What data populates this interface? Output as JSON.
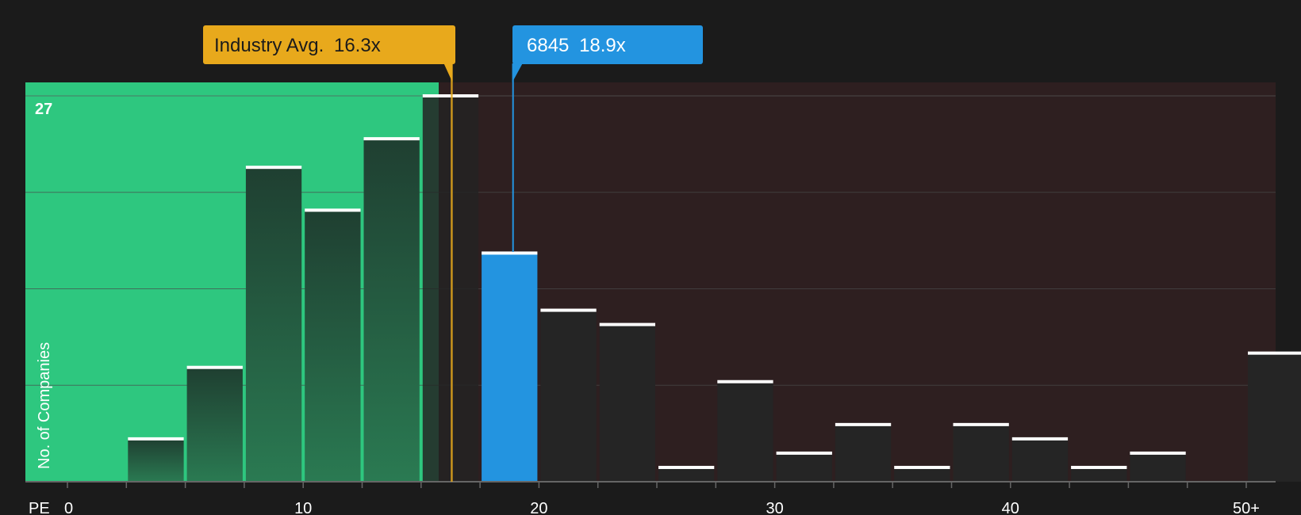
{
  "chart_data": {
    "type": "bar",
    "title": "",
    "xlabel": "PE",
    "ylabel": "No. of Companies",
    "y_max_label": "27",
    "x_tick_labels": [
      {
        "value": 0,
        "label": "0"
      },
      {
        "value": 10,
        "label": "10"
      },
      {
        "value": 20,
        "label": "20"
      },
      {
        "value": 30,
        "label": "30"
      },
      {
        "value": 40,
        "label": "40"
      },
      {
        "value": 50,
        "label": "50+"
      }
    ],
    "x_range": [
      0,
      51.25
    ],
    "y_range": [
      0,
      27
    ],
    "bin_width": 2.5,
    "bins": [
      {
        "start": 0,
        "value": 0
      },
      {
        "start": 2.5,
        "value": 3
      },
      {
        "start": 5,
        "value": 8
      },
      {
        "start": 7.5,
        "value": 22
      },
      {
        "start": 10,
        "value": 19
      },
      {
        "start": 12.5,
        "value": 24
      },
      {
        "start": 15,
        "value": 27
      },
      {
        "start": 17.5,
        "value": 16
      },
      {
        "start": 20,
        "value": 12
      },
      {
        "start": 22.5,
        "value": 11
      },
      {
        "start": 25,
        "value": 1
      },
      {
        "start": 27.5,
        "value": 7
      },
      {
        "start": 30,
        "value": 2
      },
      {
        "start": 32.5,
        "value": 4
      },
      {
        "start": 35,
        "value": 1
      },
      {
        "start": 37.5,
        "value": 4
      },
      {
        "start": 40,
        "value": 3
      },
      {
        "start": 42.5,
        "value": 1
      },
      {
        "start": 45,
        "value": 2
      },
      {
        "start": 47.5,
        "value": 0
      },
      {
        "start": 50,
        "value": 9
      }
    ],
    "highlight_bin_start": 17.5,
    "fair_zone_end": 15.75,
    "industry_avg": {
      "label": "Industry Avg.",
      "value_label": "16.3x",
      "value": 16.3
    },
    "company": {
      "ticker": "6845",
      "value_label": "18.9x",
      "value": 18.9
    },
    "colors": {
      "background": "#1b1b1b",
      "fair_zone": "#2ec77f",
      "expensive_zone": "#2e1f20",
      "bar_dark": "#252525",
      "bar_green": "#1f5a3e",
      "highlight": "#2394e0",
      "industry": "#e8a91c",
      "bar_cap": "#ffffff",
      "grid": "#4a4a4a",
      "axis": "#666666"
    }
  }
}
